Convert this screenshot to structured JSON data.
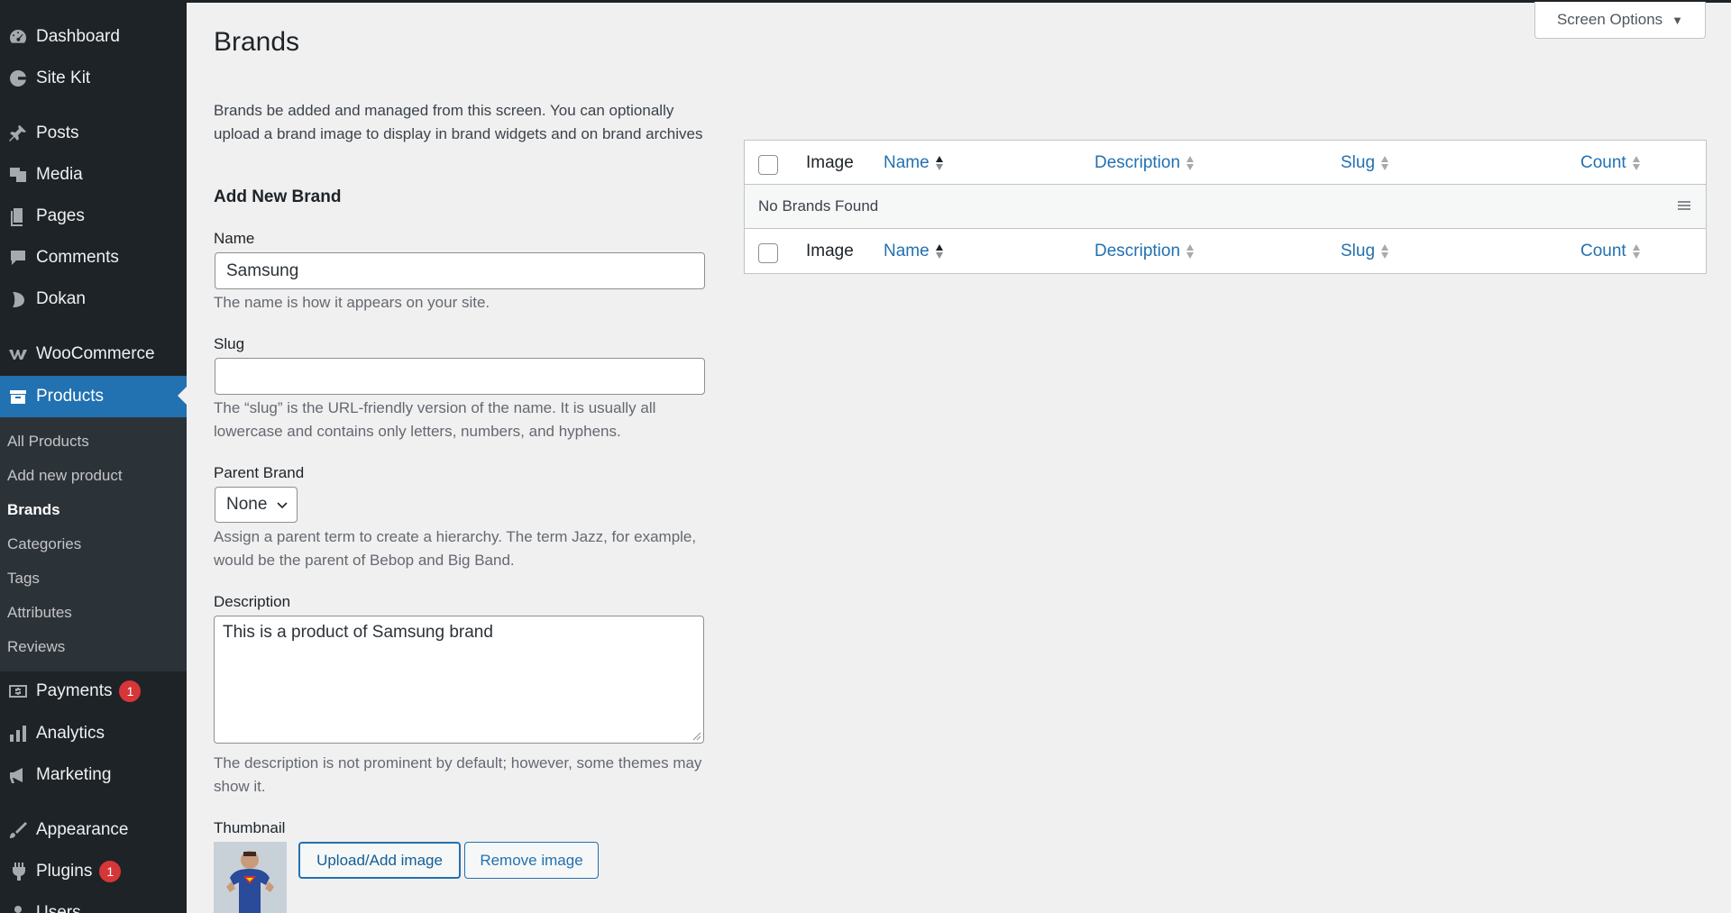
{
  "sidebar": {
    "items": [
      {
        "label": "Dashboard",
        "icon": "dashboard-icon"
      },
      {
        "label": "Site Kit",
        "icon": "sitekit-icon"
      },
      {
        "label": "Posts",
        "icon": "pin-icon"
      },
      {
        "label": "Media",
        "icon": "media-icon"
      },
      {
        "label": "Pages",
        "icon": "pages-icon"
      },
      {
        "label": "Comments",
        "icon": "comment-icon"
      },
      {
        "label": "Dokan",
        "icon": "dokan-icon"
      },
      {
        "label": "WooCommerce",
        "icon": "woocommerce-icon"
      },
      {
        "label": "Products",
        "icon": "archive-icon"
      },
      {
        "label": "Payments",
        "icon": "payments-icon",
        "badge": "1"
      },
      {
        "label": "Analytics",
        "icon": "bar-chart-icon"
      },
      {
        "label": "Marketing",
        "icon": "megaphone-icon"
      },
      {
        "label": "Appearance",
        "icon": "brush-icon"
      },
      {
        "label": "Plugins",
        "icon": "plugin-icon",
        "badge": "1"
      },
      {
        "label": "Users",
        "icon": "users-icon"
      }
    ],
    "submenu": [
      "All Products",
      "Add new product",
      "Brands",
      "Categories",
      "Tags",
      "Attributes",
      "Reviews"
    ]
  },
  "header": {
    "screen_options": "Screen Options",
    "title": "Brands"
  },
  "form": {
    "intro": "Brands be added and managed from this screen. You can optionally upload a brand image to display in brand widgets and on brand archives",
    "heading": "Add New Brand",
    "name_label": "Name",
    "name_value": "Samsung",
    "name_help": "The name is how it appears on your site.",
    "slug_label": "Slug",
    "slug_value": "",
    "slug_help": "The “slug” is the URL-friendly version of the name. It is usually all lowercase and contains only letters, numbers, and hyphens.",
    "parent_label": "Parent Brand",
    "parent_value": "None",
    "parent_help": "Assign a parent term to create a hierarchy. The term Jazz, for example, would be the parent of Bebop and Big Band.",
    "description_label": "Description",
    "description_value": "This is a product of Samsung brand",
    "description_help": "The description is not prominent by default; however, some themes may show it.",
    "thumbnail_label": "Thumbnail",
    "upload_button": "Upload/Add image",
    "remove_button": "Remove image"
  },
  "table": {
    "columns": [
      "Image",
      "Name",
      "Description",
      "Slug",
      "Count"
    ],
    "empty": "No Brands Found"
  },
  "colors": {
    "sidebar_bg": "#1d2327",
    "accent": "#2271b1",
    "badge": "#d63638"
  }
}
